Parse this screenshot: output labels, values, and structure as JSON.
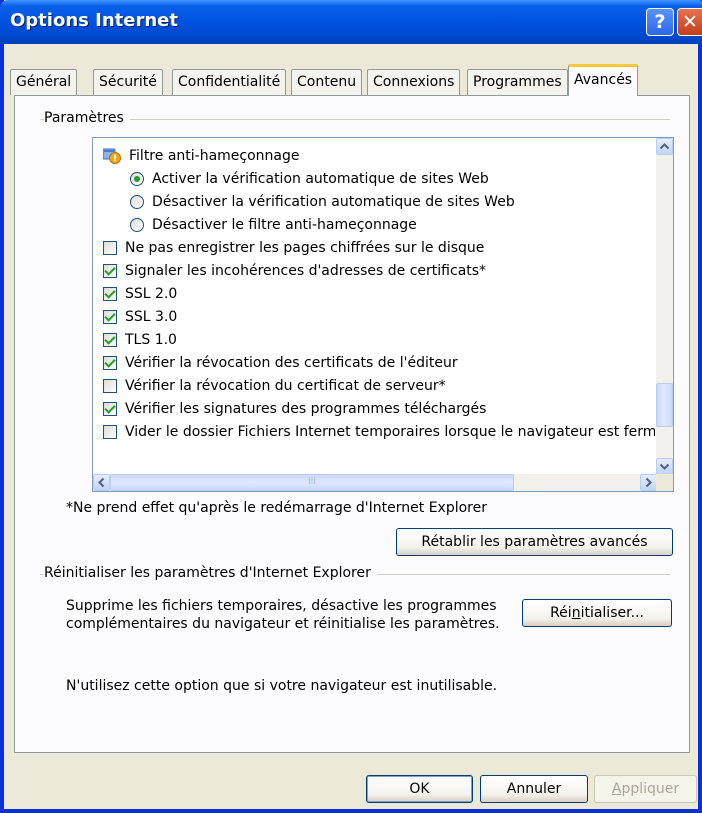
{
  "window": {
    "title": "Options Internet",
    "help_glyph": "?",
    "close_glyph": "✕"
  },
  "tabs": [
    {
      "label": "Général"
    },
    {
      "label": "Sécurité"
    },
    {
      "label": "Confidentialité"
    },
    {
      "label": "Contenu"
    },
    {
      "label": "Connexions"
    },
    {
      "label": "Programmes"
    },
    {
      "label": "Avancés",
      "active": true
    }
  ],
  "settings_group": {
    "label": "Paramètres"
  },
  "settings_list": {
    "phishing_header": {
      "label": "Filtre anti-hameçonnage",
      "icon": "shield-warning-icon"
    },
    "phishing_options": [
      {
        "label": "Activer la vérification automatique de sites Web",
        "checked": true
      },
      {
        "label": "Désactiver la vérification automatique de sites Web",
        "checked": false
      },
      {
        "label": "Désactiver le filtre anti-hameçonnage",
        "checked": false
      }
    ],
    "checkboxes": [
      {
        "label": "Ne pas enregistrer les pages chiffrées sur le disque",
        "checked": false
      },
      {
        "label": "Signaler les incohérences d'adresses de certificats*",
        "checked": true
      },
      {
        "label": "SSL 2.0",
        "checked": true
      },
      {
        "label": "SSL 3.0",
        "checked": true
      },
      {
        "label": "TLS 1.0",
        "checked": true
      },
      {
        "label": "Vérifier la révocation des certificats de l'éditeur",
        "checked": true
      },
      {
        "label": "Vérifier la révocation du certificat de serveur*",
        "checked": false
      },
      {
        "label": "Vérifier les signatures des programmes téléchargés",
        "checked": true
      },
      {
        "label": "Vider le dossier Fichiers Internet temporaires lorsque le navigateur est ferm",
        "checked": false
      }
    ],
    "scrollbar_thumb_glyph": "III"
  },
  "restart_note": "*Ne prend effet qu'après le redémarrage d'Internet Explorer",
  "restore_button": "Rétablir les paramètres avancés",
  "reset_group": {
    "label": "Réinitialiser les paramètres d'Internet Explorer",
    "description_line1": "Supprime les fichiers temporaires, désactive les programmes",
    "description_line2": "complémentaires du navigateur et réinitialise les paramètres.",
    "button_pre": "Réi",
    "button_accel": "n",
    "button_post": "itialiser...",
    "warning": "N'utilisez cette option que si votre navigateur est inutilisable."
  },
  "footer": {
    "ok": "OK",
    "cancel": "Annuler",
    "apply_accel": "A",
    "apply_rest": "ppliquer"
  }
}
